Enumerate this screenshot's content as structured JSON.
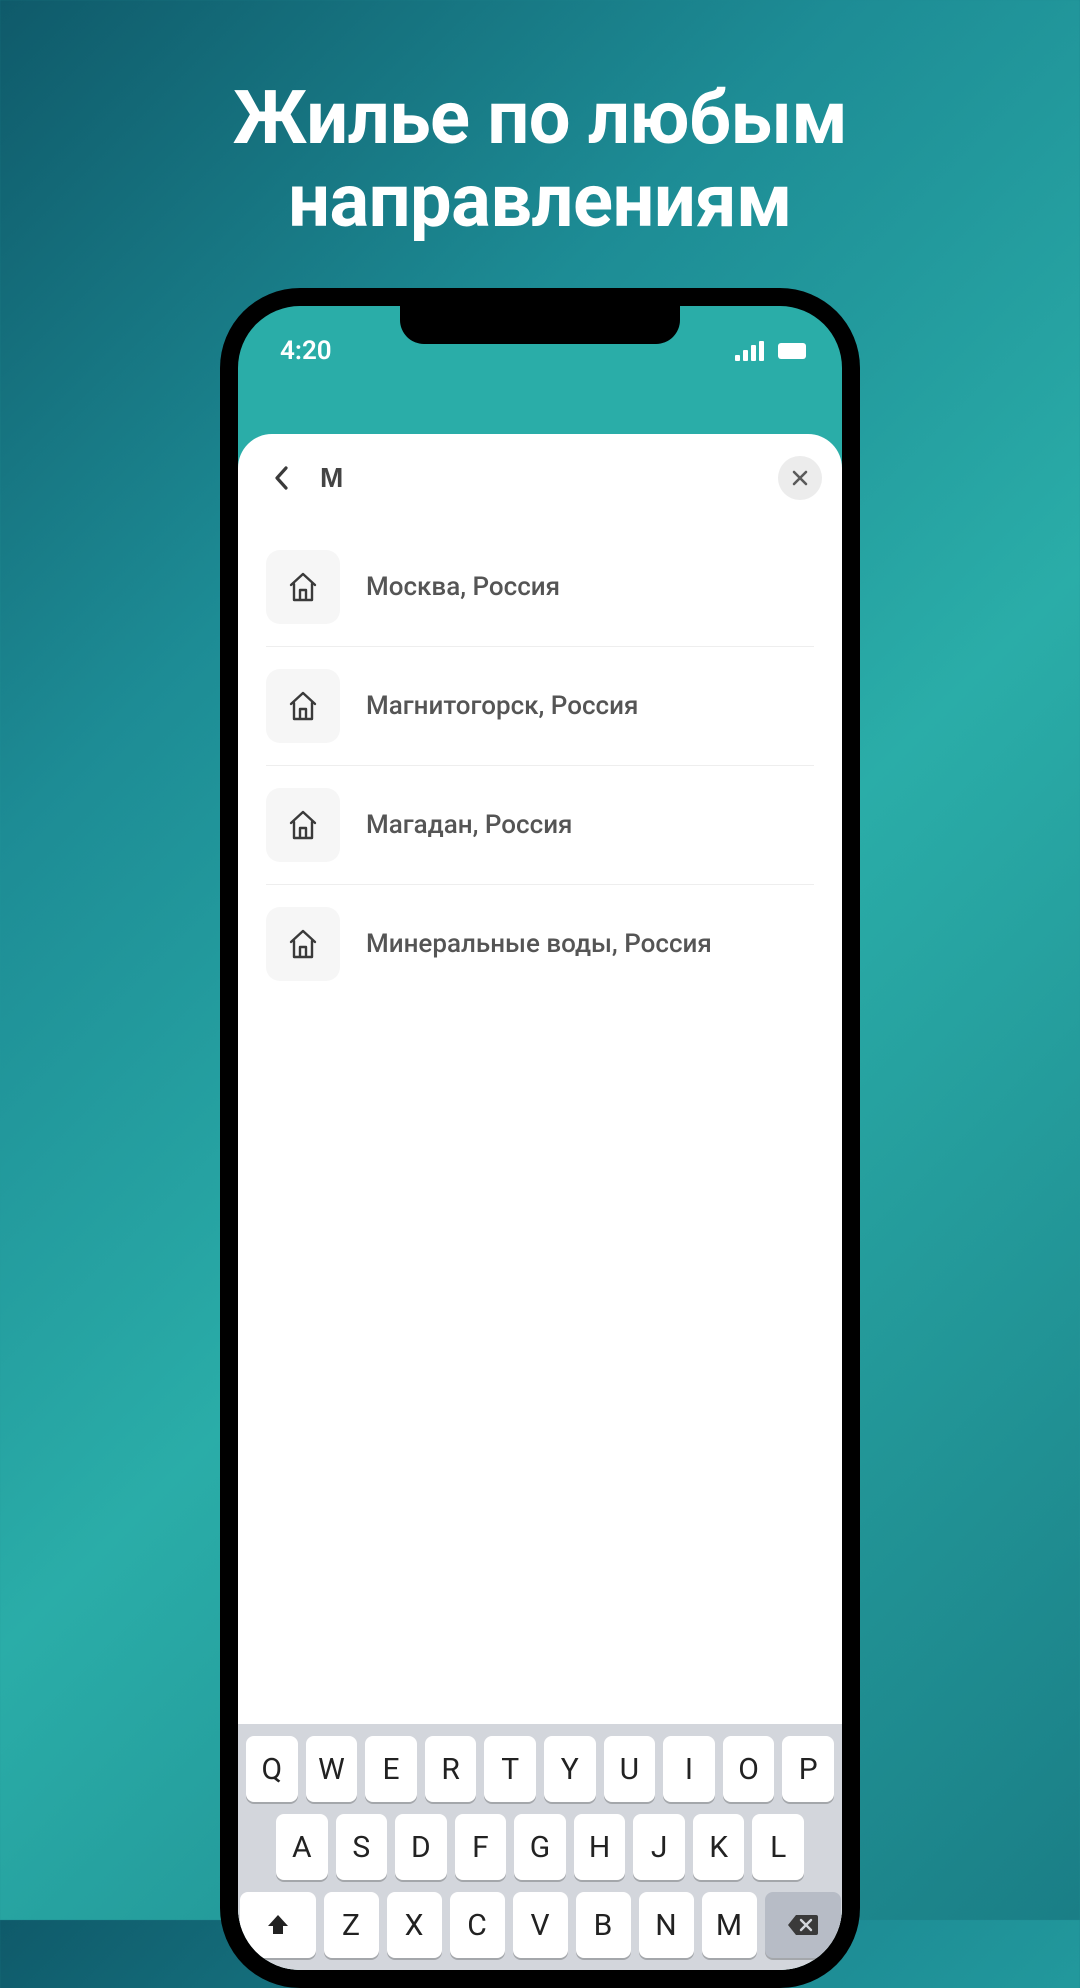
{
  "marketing": {
    "headline": "Жилье по любым направлениям"
  },
  "status_bar": {
    "time": "4:20"
  },
  "search": {
    "query": "М"
  },
  "results": [
    {
      "label": "Москва, Россия"
    },
    {
      "label": "Магнитогорск, Россия"
    },
    {
      "label": "Магадан, Россия"
    },
    {
      "label": "Минеральные воды, Россия"
    }
  ],
  "keyboard": {
    "row1": [
      "Q",
      "W",
      "E",
      "R",
      "T",
      "Y",
      "U",
      "I",
      "O",
      "P"
    ],
    "row2": [
      "A",
      "S",
      "D",
      "F",
      "G",
      "H",
      "J",
      "K",
      "L"
    ],
    "row3": [
      "Z",
      "X",
      "C",
      "V",
      "B",
      "N",
      "M"
    ]
  }
}
